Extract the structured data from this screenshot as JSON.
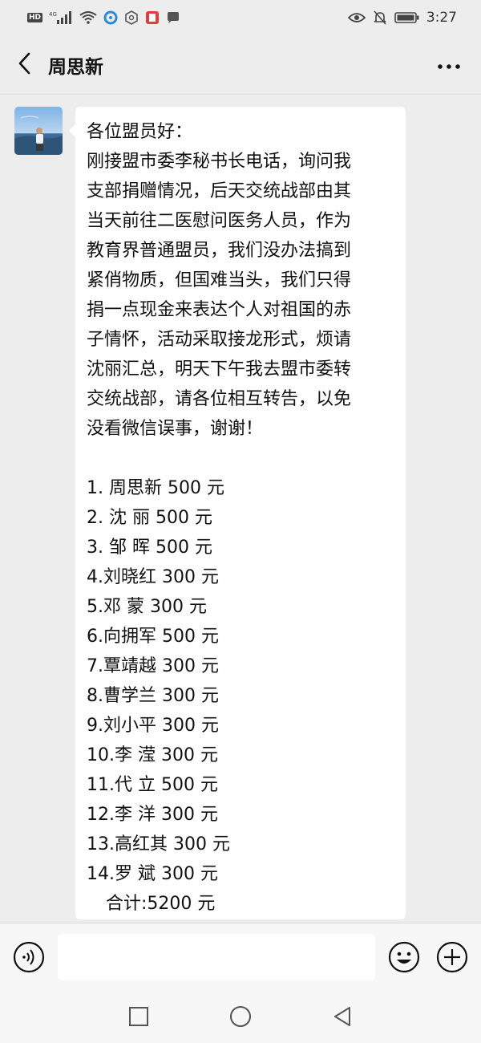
{
  "status_bar": {
    "hd": "HD",
    "network": "4G",
    "time": "3:27"
  },
  "header": {
    "title": "周思新",
    "back_icon": "chevron-left-icon",
    "more_icon": "more-dots-icon"
  },
  "message": {
    "lines": [
      "各位盟员好：",
      "刚接盟市委李秘书长电话，询问我",
      "支部捐赠情况，后天交统战部由其",
      "当天前往二医慰问医务人员，作为",
      "教育界普通盟员，我们没办法搞到",
      "紧俏物质，但国难当头，我们只得",
      "捐一点现金来表达个人对祖国的赤",
      "子情怀，活动采取接龙形式，烦请",
      "沈丽汇总，明天下午我去盟市委转",
      "交统战部，请各位相互转告，以免",
      "没看微信误事，谢谢！"
    ],
    "list": [
      "1. 周思新 500 元",
      "2. 沈  丽 500 元",
      "3. 邹  晖 500 元",
      "4.刘晓红 300 元",
      "5.邓  蒙  300 元",
      "6.向拥军 500 元",
      "7.覃靖越 300 元",
      "8.曹学兰 300 元",
      "9.刘小平 300 元",
      "10.李  滢 300 元",
      "11.代  立 500 元",
      "12.李  洋 300 元",
      "13.高红其 300 元",
      "14.罗   斌 300 元"
    ],
    "total": "合计:5200 元"
  },
  "input_bar": {
    "voice_icon": "voice-icon",
    "input_value": "",
    "emoji_icon": "emoji-icon",
    "plus_icon": "plus-icon"
  },
  "nav": {
    "back_icon": "nav-back-icon",
    "home_icon": "nav-home-icon",
    "recents_icon": "nav-recents-icon"
  },
  "colors": {
    "background": "#ededed",
    "bubble": "#ffffff",
    "text": "#111111"
  }
}
